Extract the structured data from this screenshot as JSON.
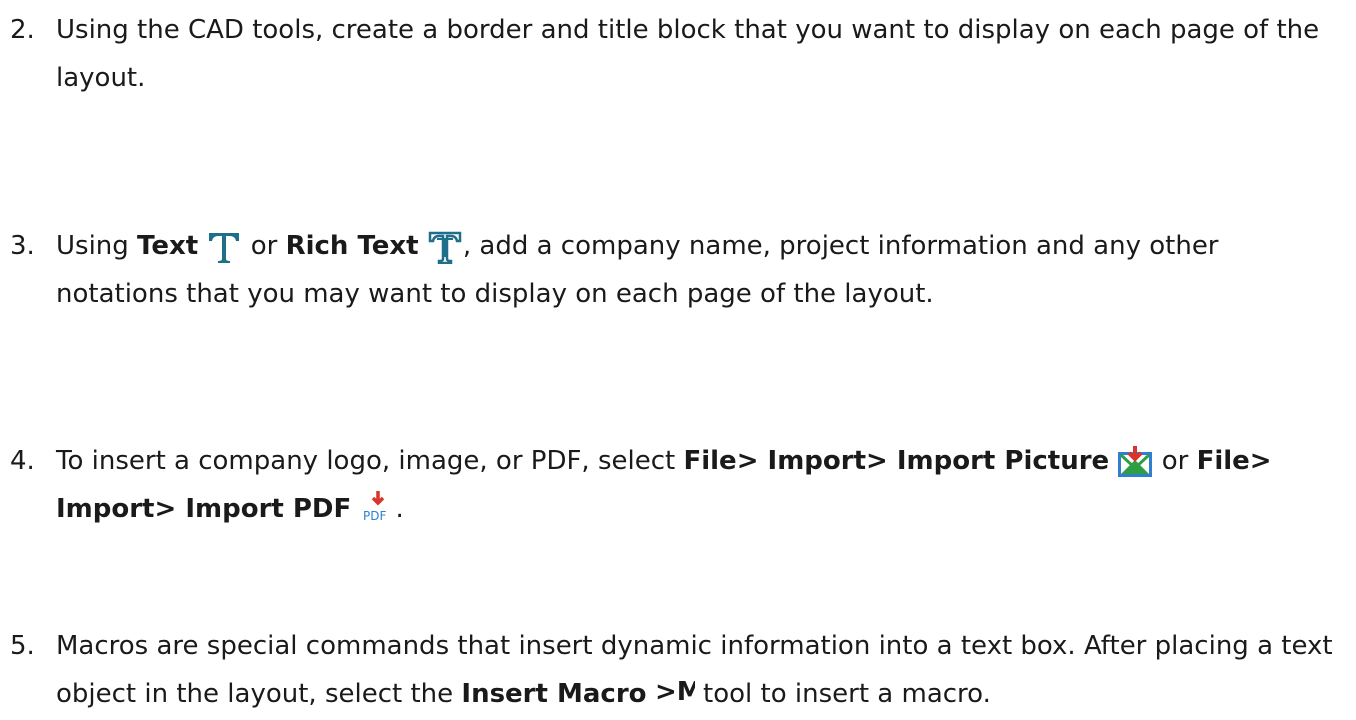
{
  "steps": [
    {
      "number": "2.",
      "text": "Using the CAD tools, create a border and title block that you want to display on each page of the layout."
    },
    {
      "number": "3.",
      "pre": "Using ",
      "bold1": "Text",
      "icon1": "text-tool-icon",
      "mid": " or ",
      "bold2": "Rich Text",
      "icon2": "rich-text-tool-icon",
      "post": ", add a company name, project information and any other notations that you may want to display on each page of the layout."
    },
    {
      "number": "4.",
      "pre": "To insert a company logo, image, or PDF, select ",
      "bold1": "File> Import> Import Picture",
      "icon1": "import-picture-icon",
      "mid": " or ",
      "bold2": "File> Import> Import PDF",
      "icon2": "import-pdf-icon",
      "icon2_label": "PDF",
      "post": "."
    },
    {
      "number": "5.",
      "pre": "Macros are special commands that insert dynamic information into a text box. After placing a text object in the layout, select the ",
      "bold1": "Insert Macro",
      "icon1": "insert-macro-icon",
      "icon1_label": ">M",
      "post": " tool to insert a macro."
    }
  ],
  "colors": {
    "text": "#1a1a1a",
    "text_icon": "#1f6f8b",
    "import_red": "#d8342b",
    "import_green": "#2e9e44",
    "import_blue": "#2f7fd1"
  }
}
